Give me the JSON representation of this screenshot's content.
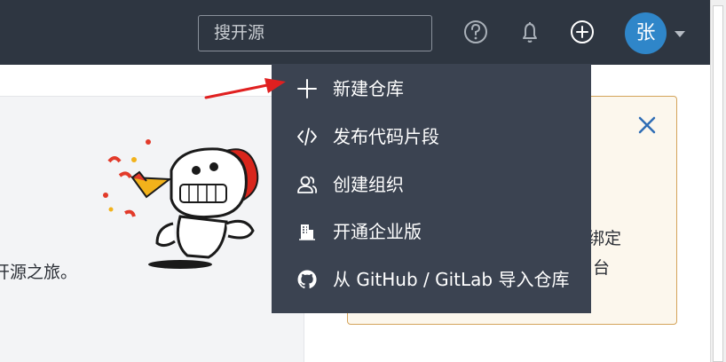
{
  "header": {
    "search_placeholder": "搜开源",
    "avatar_initial": "张",
    "icons": [
      "help-icon",
      "bell-icon",
      "plus-circle-icon",
      "chevron-down-icon"
    ]
  },
  "welcome": {
    "text_fragment": "开源之旅。"
  },
  "notice": {
    "line1": "绑定",
    "line2": "台"
  },
  "create_menu": {
    "items": [
      {
        "label": "新建仓库",
        "icon": "plus-icon"
      },
      {
        "label": "发布代码片段",
        "icon": "code-icon"
      },
      {
        "label": "创建组织",
        "icon": "users-icon"
      },
      {
        "label": "开通企业版",
        "icon": "building-icon"
      },
      {
        "label": "从 GitHub / GitLab 导入仓库",
        "icon": "github-icon"
      }
    ]
  },
  "colors": {
    "topbar": "#2e3641",
    "menu": "#3b4351",
    "avatar": "#2f86c9",
    "notice_border": "#d4a45a",
    "notice_bg": "#fcf7ed",
    "arrow": "#e02020",
    "close_icon": "#2f6db5"
  }
}
